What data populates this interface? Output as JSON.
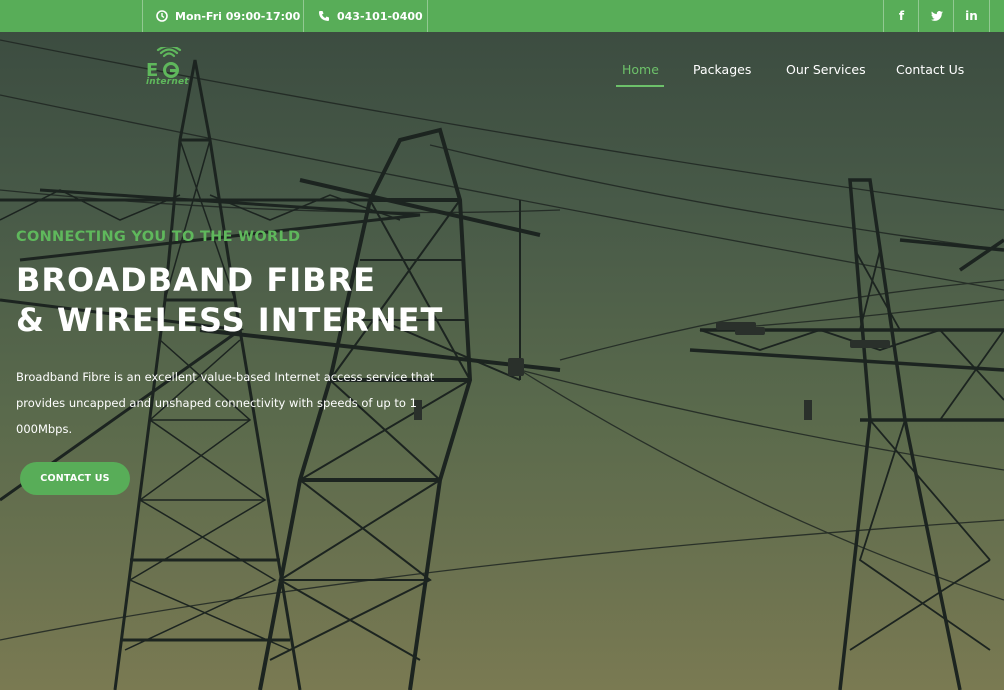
{
  "topbar": {
    "hours": "Mon-Fri 09:00-17:00",
    "phone": "043-101-0400",
    "social": {
      "facebook": "f",
      "twitter_icon": "twitter-icon",
      "linkedin": "in"
    }
  },
  "header": {
    "logo_text": "internet",
    "nav": [
      {
        "label": "Home",
        "active": true
      },
      {
        "label": "Packages",
        "active": false
      },
      {
        "label": "Our Services",
        "active": false
      },
      {
        "label": "Contact Us",
        "active": false
      }
    ]
  },
  "hero": {
    "tagline": "CONNECTING YOU TO THE WORLD",
    "title_line1": "BROADBAND FIBRE",
    "title_line2": "& WIRELESS INTERNET",
    "description": "Broadband Fibre is an excellent value-based Internet access service that provides uncapped and unshaped connectivity with speeds of up to 1 000Mbps.",
    "cta_label": "CONTACT US"
  },
  "colors": {
    "accent": "#58ad58",
    "nav_active": "#6dc16a",
    "background_dark": "#3a4a3f"
  }
}
